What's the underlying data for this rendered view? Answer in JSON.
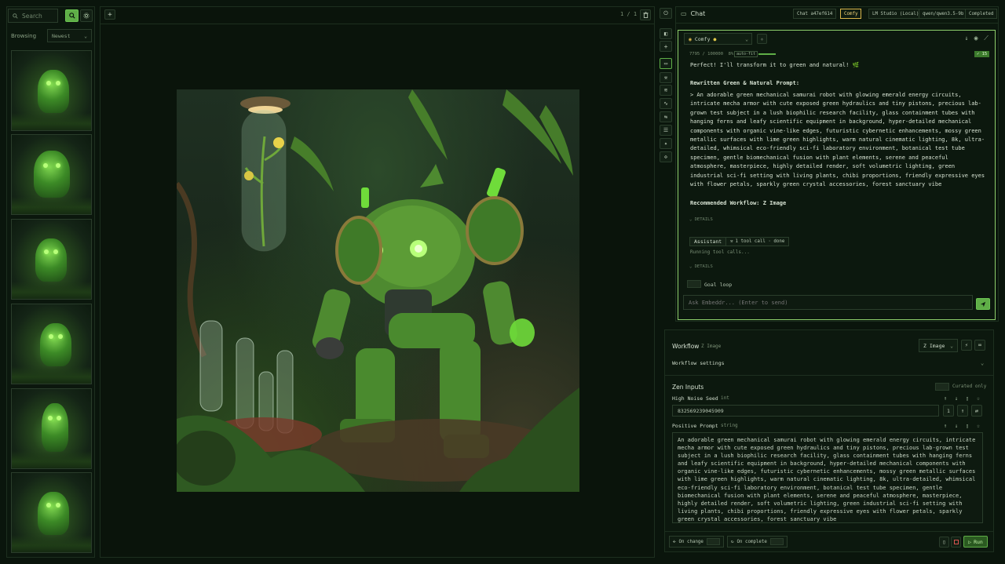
{
  "sidebar": {
    "search_placeholder": "Search",
    "browsing_label": "Browsing",
    "sort_value": "Newest",
    "thumbnail_count": 6
  },
  "canvas": {
    "page_indicator": "1 / 1"
  },
  "chat": {
    "title": "Chat",
    "chips": [
      "Chat a47ef614",
      "Comfy",
      "LM Studio (Local)",
      "qwen/qwen3.5-9b",
      "Completed"
    ],
    "model": "Comfy",
    "token_count": "7795 / 100000",
    "token_pct": "8%",
    "auto_fit": "auto-fit",
    "token_badge": "15",
    "intro": "Perfect! I'll transform it to green and natural! 🌿",
    "heading": "Rewritten Green & Natural Prompt:",
    "prompt": "> An adorable green mechanical samurai robot with glowing emerald energy circuits, intricate mecha armor with cute exposed green hydraulics and tiny pistons, precious lab-grown test subject in a lush biophilic research facility, glass containment tubes with hanging ferns and leafy scientific equipment in background, hyper-detailed mechanical components with organic vine-like edges, futuristic cybernetic enhancements, mossy green metallic surfaces with lime green highlights, warm natural cinematic lighting, 8k, ultra-detailed, whimsical eco-friendly sci-fi laboratory environment, botanical test tube specimen, gentle biomechanical fusion with plant elements, serene and peaceful atmosphere, masterpiece, highly detailed render, soft volumetric lighting, green industrial sci-fi setting with living plants, chibi proportions, friendly expressive eyes with flower petals, sparkly green crystal accessories, forest sanctuary vibe",
    "workflow_line": "Recommended Workflow: Z Image",
    "details_label": "DETAILS",
    "assistant_label": "Assistant",
    "tool_call_label": "1 tool call · done",
    "running_label": "Running tool calls...",
    "goal_loop_label": "Goal loop",
    "input_placeholder": "Ask Embeddr... (Enter to send)"
  },
  "workflow": {
    "title": "Workflow",
    "subtitle": "Z Image",
    "selected": "Z Image",
    "settings_label": "Workflow settings",
    "zen_title": "Zen Inputs",
    "curated_label": "Curated only",
    "seed_label": "High Noise Seed",
    "seed_type": "int",
    "seed_value": "832569239045909",
    "seed_step": "1",
    "prompt_label": "Positive Prompt",
    "prompt_type": "string",
    "prompt_value": "An adorable green mechanical samurai robot with glowing emerald energy circuits, intricate mecha armor with cute exposed green hydraulics and tiny pistons, precious lab-grown test subject in a lush biophilic research facility, glass containment tubes with hanging ferns and leafy scientific equipment in background, hyper-detailed mechanical components with organic vine-like edges, futuristic cybernetic enhancements, mossy green metallic surfaces with lime green highlights, warm natural cinematic lighting, 8k, ultra-detailed, whimsical eco-friendly sci-fi laboratory environment, botanical test tube specimen, gentle biomechanical fusion with plant elements, serene and peaceful atmosphere, masterpiece, highly detailed render, soft volumetric lighting, green industrial sci-fi setting with living plants, chibi proportions, friendly expressive eyes with flower petals, sparkly green crystal accessories, forest sanctuary vibe",
    "on_change_label": "On change",
    "on_complete_label": "On complete",
    "run_label": "Run"
  },
  "colors": {
    "accent": "#5fae47",
    "panel_border": "#1d2f1f",
    "active_chip": "#d9b54a"
  }
}
